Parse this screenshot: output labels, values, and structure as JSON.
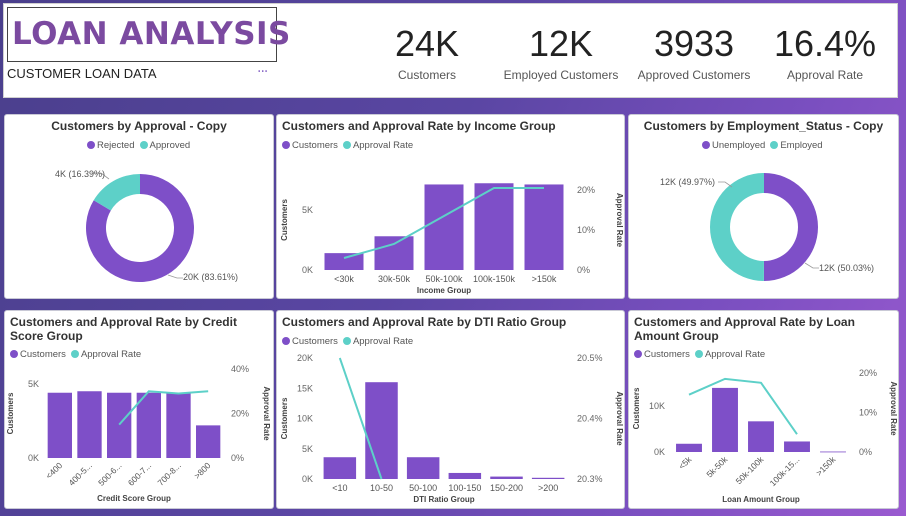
{
  "header": {
    "title": "LOAN ANALYSIS",
    "subtitle": "CUSTOMER LOAN DATA",
    "more_icon": "···",
    "kpis": [
      {
        "value": "24K",
        "label": "Customers"
      },
      {
        "value": "12K",
        "label": "Employed Customers"
      },
      {
        "value": "3933",
        "label": "Approved Customers"
      },
      {
        "value": "16.4%",
        "label": "Approval Rate"
      }
    ]
  },
  "colors": {
    "purple": "#7e4fc8",
    "teal": "#5dd0c8"
  },
  "chart_data": [
    {
      "type": "pie",
      "title": "Customers by Approval - Copy",
      "legend": [
        "Rejected",
        "Approved"
      ],
      "slices": [
        {
          "name": "Rejected",
          "value": 83.61,
          "label": "20K (83.61%)"
        },
        {
          "name": "Approved",
          "value": 16.39,
          "label": "4K (16.39%)"
        }
      ]
    },
    {
      "type": "bar",
      "title": "Customers and Approval Rate by Income Group",
      "legend": [
        "Customers",
        "Approval Rate"
      ],
      "categories": [
        "<30k",
        "30k-50k",
        "50k-100k",
        "100k-150k",
        ">150k"
      ],
      "series": [
        {
          "name": "Customers",
          "values": [
            1400,
            2800,
            7100,
            7200,
            7100
          ]
        },
        {
          "name": "Approval Rate",
          "values": [
            3.0,
            6.5,
            13.5,
            20.5,
            20.5
          ]
        }
      ],
      "xlabel": "Income Group",
      "ylabel": "Customers",
      "y2label": "Approval Rate",
      "ylim": [
        0,
        8300
      ],
      "y2lim": [
        0,
        25
      ],
      "yticks": [
        "0K",
        "5K"
      ],
      "y2ticks": [
        "0%",
        "10%",
        "20%"
      ]
    },
    {
      "type": "pie",
      "title": "Customers by Employment_Status - Copy",
      "legend": [
        "Unemployed",
        "Employed"
      ],
      "slices": [
        {
          "name": "Unemployed",
          "value": 50.03,
          "label": "12K (50.03%)"
        },
        {
          "name": "Employed",
          "value": 49.97,
          "label": "12K (49.97%)"
        }
      ]
    },
    {
      "type": "bar",
      "title": "Customers and Approval Rate by Credit Score Group",
      "legend": [
        "Customers",
        "Approval Rate"
      ],
      "categories": [
        "<400",
        "400-5...",
        "500-6...",
        "600-7...",
        "700-8...",
        ">800"
      ],
      "series": [
        {
          "name": "Customers",
          "values": [
            4400,
            4500,
            4400,
            4400,
            4400,
            2200
          ]
        },
        {
          "name": "Approval Rate",
          "values": [
            null,
            null,
            15.0,
            30.0,
            29.0,
            30.0
          ]
        }
      ],
      "xlabel": "Credit Score Group",
      "ylabel": "Customers",
      "y2label": "Approval Rate",
      "ylim": [
        0,
        6000
      ],
      "y2lim": [
        0,
        40
      ],
      "yticks": [
        "0K",
        "5K"
      ],
      "y2ticks": [
        "0%",
        "20%",
        "40%"
      ]
    },
    {
      "type": "bar",
      "title": "Customers and Approval Rate by DTI Ratio Group",
      "legend": [
        "Customers",
        "Approval Rate"
      ],
      "categories": [
        "<10",
        "10-50",
        "50-100",
        "100-150",
        "150-200",
        ">200"
      ],
      "series": [
        {
          "name": "Customers",
          "values": [
            3600,
            16000,
            3600,
            1000,
            400,
            200
          ]
        },
        {
          "name": "Approval Rate",
          "values": [
            20.5,
            20.3,
            null,
            null,
            null,
            null
          ]
        }
      ],
      "xlabel": "DTI Ratio Group",
      "ylabel": "Customers",
      "y2label": "Approval Rate",
      "ylim": [
        0,
        20000
      ],
      "y2lim": [
        20.3,
        20.5
      ],
      "yticks": [
        "0K",
        "5K",
        "10K",
        "15K",
        "20K"
      ],
      "y2ticks": [
        "20.3%",
        "20.4%",
        "20.5%"
      ]
    },
    {
      "type": "bar",
      "title": "Customers and Approval Rate by Loan Amount Group",
      "legend": [
        "Customers",
        "Approval Rate"
      ],
      "categories": [
        "<5k",
        "5k-50k",
        "50k-100k",
        "100k-15...",
        ">150k"
      ],
      "series": [
        {
          "name": "Customers",
          "values": [
            1800,
            14000,
            6700,
            2300,
            100
          ]
        },
        {
          "name": "Approval Rate",
          "values": [
            14.5,
            18.5,
            17.5,
            4.5,
            null
          ]
        }
      ],
      "xlabel": "Loan Amount Group",
      "ylabel": "Customers",
      "y2label": "Approval Rate",
      "ylim": [
        0,
        19000
      ],
      "y2lim": [
        0,
        22
      ],
      "yticks": [
        "0K",
        "10K"
      ],
      "y2ticks": [
        "0%",
        "10%",
        "20%"
      ]
    }
  ]
}
